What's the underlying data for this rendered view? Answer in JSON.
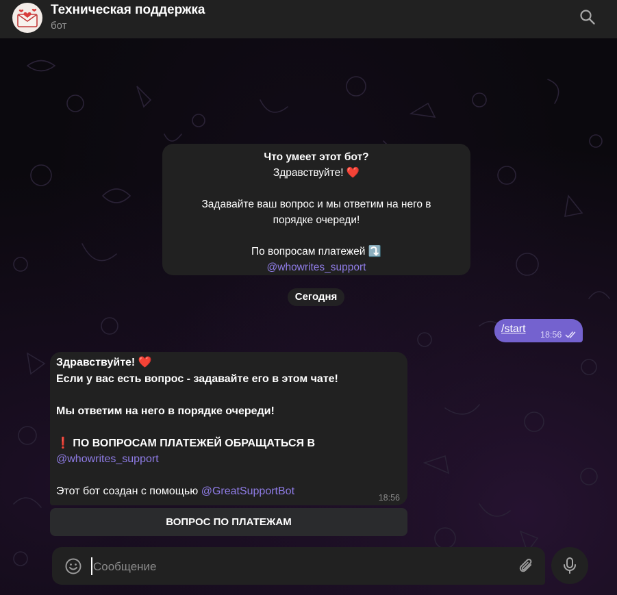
{
  "header": {
    "title": "Техническая поддержка",
    "subtitle": "бот",
    "search_icon": "search-icon",
    "avatar_icon": "envelope-hearts-icon"
  },
  "info_card": {
    "question": "Что умеет этот бот?",
    "greeting": "Здравствуйте! ❤️",
    "line1": "Задавайте ваш вопрос и мы ответим на него в",
    "line2": "порядке очереди!",
    "payments": "По вопросам платежей ⤵️",
    "link": "@whowrites_support"
  },
  "date_separator": "Сегодня",
  "outgoing": {
    "text": "/start",
    "time": "18:56",
    "status_icon": "double-check-icon"
  },
  "incoming": {
    "greeting": "Здравствуйте! ❤️",
    "line1": "Если у вас есть вопрос - задавайте его в этом чате!",
    "line2": "Мы ответим на него в порядке очереди!",
    "alert": "❗ ПО ВОПРОСАМ ПЛАТЕЖЕЙ ОБРАЩАТЬСЯ В",
    "alert_link": "@whowrites_support",
    "footer_prefix": "Этот бот создан с помощью ",
    "footer_link": "@GreatSupportBot",
    "time": "18:56"
  },
  "keyboard_button": "ВОПРОС ПО ПЛАТЕЖАМ",
  "composer": {
    "placeholder": "Сообщение"
  },
  "colors": {
    "accent": "#8f7ce6",
    "outgoing_bubble": "#7462cf",
    "panel": "#212121"
  }
}
